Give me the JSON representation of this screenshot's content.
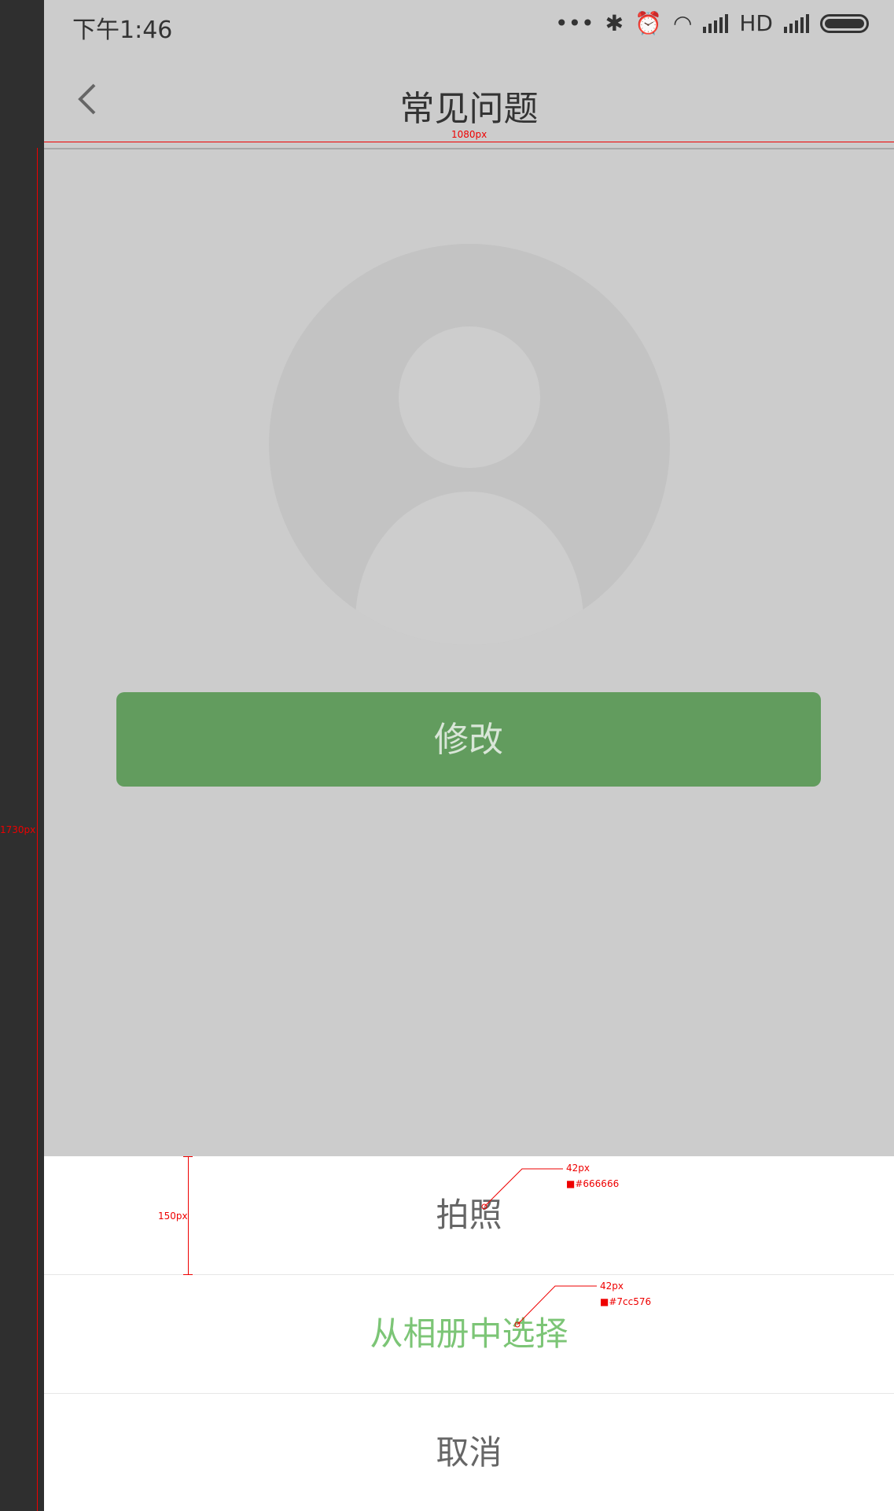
{
  "status_bar": {
    "time": "下午1:46",
    "network_label": "HD"
  },
  "nav": {
    "title": "常见问题"
  },
  "main": {
    "modify_button": "修改"
  },
  "action_sheet": {
    "items": [
      {
        "label": "拍照",
        "color": "#666666"
      },
      {
        "label": "从相册中选择",
        "color": "#7cc576"
      },
      {
        "label": "取消",
        "color": "#666666"
      }
    ]
  },
  "annotations": {
    "width_label": "1080px",
    "height_label": "1730px",
    "row_height_label": "150px",
    "font_size_1": "42px",
    "color_1": "#666666",
    "font_size_2": "42px",
    "color_2": "#7cc576"
  },
  "colors": {
    "accent_green": "#629c5e",
    "overlay_gray": "#cccccc"
  }
}
